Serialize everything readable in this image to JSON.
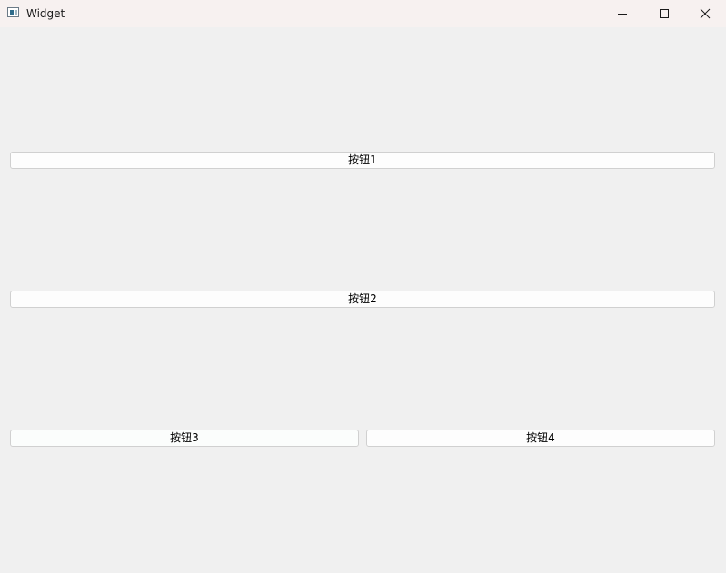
{
  "window": {
    "title": "Widget",
    "icon": "app-window-icon",
    "caption_buttons": {
      "minimize_icon": "minimize-icon",
      "maximize_icon": "maximize-icon",
      "close_icon": "close-icon"
    }
  },
  "buttons": {
    "button1": "按钮1",
    "button2": "按钮2",
    "button3": "按钮3",
    "button4": "按钮4"
  },
  "colors": {
    "titlebar_bg": "#f7f1f0",
    "client_bg": "#f0f0f0",
    "button_bg": "#fdfdfd",
    "button_border": "#d0d0d0"
  }
}
